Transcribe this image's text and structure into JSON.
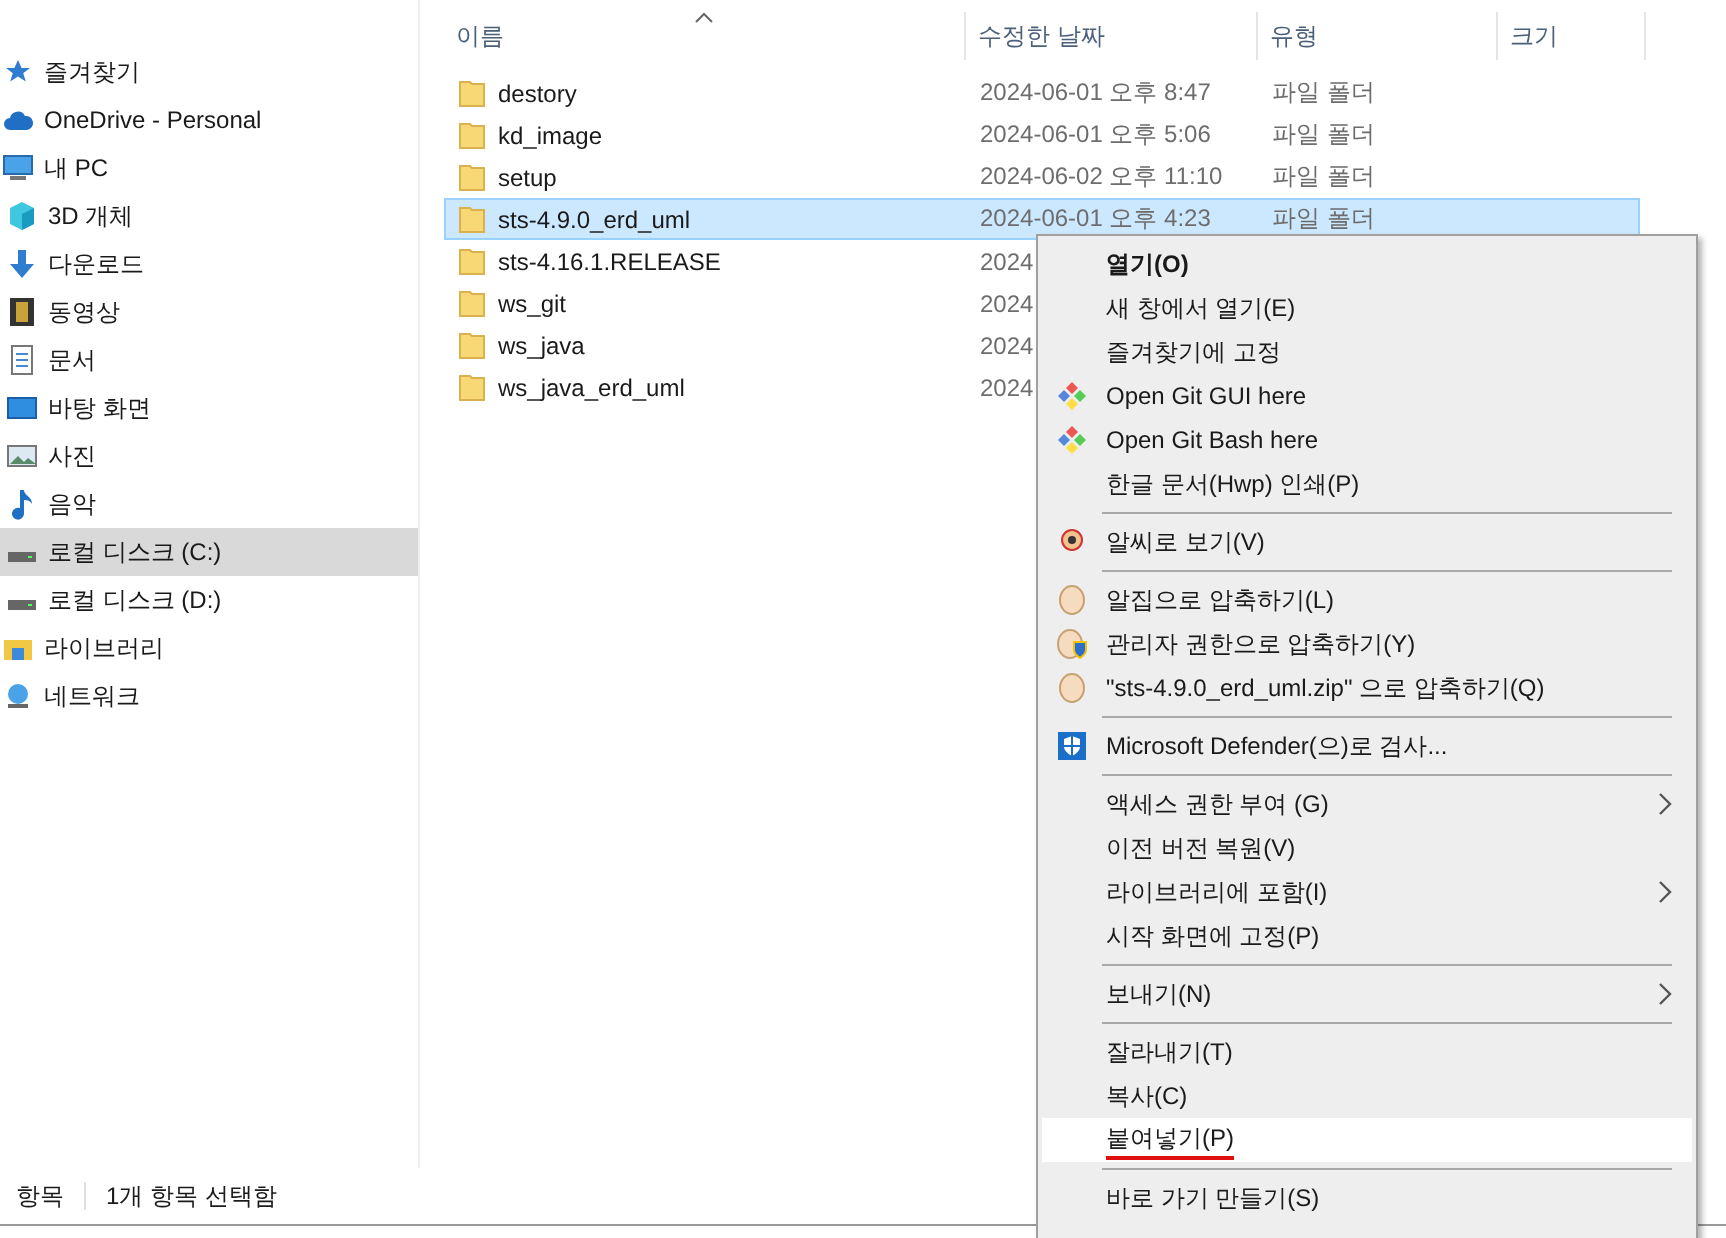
{
  "sidebar": {
    "items": [
      {
        "label": "즐겨찾기",
        "kind": "star",
        "selected": false
      },
      {
        "label": "OneDrive - Personal",
        "kind": "cloud",
        "selected": false
      },
      {
        "label": "내 PC",
        "kind": "pc",
        "selected": false,
        "children": [
          {
            "label": "3D 개체",
            "kind": "cube",
            "selected": false
          },
          {
            "label": "다운로드",
            "kind": "download",
            "selected": false
          },
          {
            "label": "동영상",
            "kind": "film",
            "selected": false
          },
          {
            "label": "문서",
            "kind": "doc",
            "selected": false
          },
          {
            "label": "바탕 화면",
            "kind": "desktop",
            "selected": false
          },
          {
            "label": "사진",
            "kind": "picture",
            "selected": false
          },
          {
            "label": "음악",
            "kind": "music",
            "selected": false
          },
          {
            "label": "로컬 디스크 (C:)",
            "kind": "drive",
            "selected": true
          },
          {
            "label": "로컬 디스크 (D:)",
            "kind": "drive",
            "selected": false
          }
        ]
      },
      {
        "label": "라이브러리",
        "kind": "library",
        "selected": false
      },
      {
        "label": "네트워크",
        "kind": "network",
        "selected": false
      }
    ]
  },
  "table": {
    "columns": [
      "이름",
      "수정한 날짜",
      "유형",
      "크기"
    ],
    "rows": [
      {
        "name": "destory",
        "date": "2024-06-01 오후 8:47",
        "type": "파일 폴더",
        "selected": false
      },
      {
        "name": "kd_image",
        "date": "2024-06-01 오후 5:06",
        "type": "파일 폴더",
        "selected": false
      },
      {
        "name": "setup",
        "date": "2024-06-02 오후 11:10",
        "type": "파일 폴더",
        "selected": false
      },
      {
        "name": "sts-4.9.0_erd_uml",
        "date": "2024-06-01 오후 4:23",
        "type": "파일 폴더",
        "selected": true
      },
      {
        "name": "sts-4.16.1.RELEASE",
        "date": "2024",
        "selected": false
      },
      {
        "name": "ws_git",
        "date": "2024",
        "selected": false
      },
      {
        "name": "ws_java",
        "date": "2024",
        "selected": false
      },
      {
        "name": "ws_java_erd_uml",
        "date": "2024",
        "selected": false
      }
    ]
  },
  "status_bar": {
    "count": "항목",
    "selection": "1개 항목 선택함"
  },
  "context_menu": {
    "items": [
      {
        "kind": "plain",
        "label": "열기(O)",
        "bold": true
      },
      {
        "kind": "plain",
        "label": "새 창에서 열기(E)"
      },
      {
        "kind": "plain",
        "label": "즐겨찾기에 고정"
      },
      {
        "kind": "git",
        "label": "Open Git GUI here"
      },
      {
        "kind": "git",
        "label": "Open Git Bash here"
      },
      {
        "kind": "plain",
        "label": "한글 문서(Hwp) 인쇄(P)"
      },
      {
        "kind": "separator"
      },
      {
        "kind": "viewer",
        "label": "알씨로 보기(V)"
      },
      {
        "kind": "separator"
      },
      {
        "kind": "egg",
        "label": "알집으로 압축하기(L)"
      },
      {
        "kind": "egg-shield",
        "label": "관리자 권한으로 압축하기(Y)"
      },
      {
        "kind": "egg",
        "label": "\"sts-4.9.0_erd_uml.zip\" 으로 압축하기(Q)"
      },
      {
        "kind": "separator"
      },
      {
        "kind": "shield",
        "label": "Microsoft Defender(으)로 검사..."
      },
      {
        "kind": "separator"
      },
      {
        "kind": "plain",
        "label": "액세스 권한 부여 (G)",
        "submenu": true
      },
      {
        "kind": "plain",
        "label": "이전 버전 복원(V)"
      },
      {
        "kind": "plain",
        "label": "라이브러리에 포함(I)",
        "submenu": true
      },
      {
        "kind": "plain",
        "label": "시작 화면에 고정(P)"
      },
      {
        "kind": "separator"
      },
      {
        "kind": "plain",
        "label": "보내기(N)",
        "submenu": true
      },
      {
        "kind": "separator"
      },
      {
        "kind": "plain",
        "label": "잘라내기(T)"
      },
      {
        "kind": "plain",
        "label": "복사(C)"
      },
      {
        "kind": "plain",
        "label": "붙여넣기(P)",
        "hovered": true,
        "marked": true
      },
      {
        "kind": "separator"
      },
      {
        "kind": "plain",
        "label": "바로 가기 만들기(S)"
      }
    ]
  }
}
